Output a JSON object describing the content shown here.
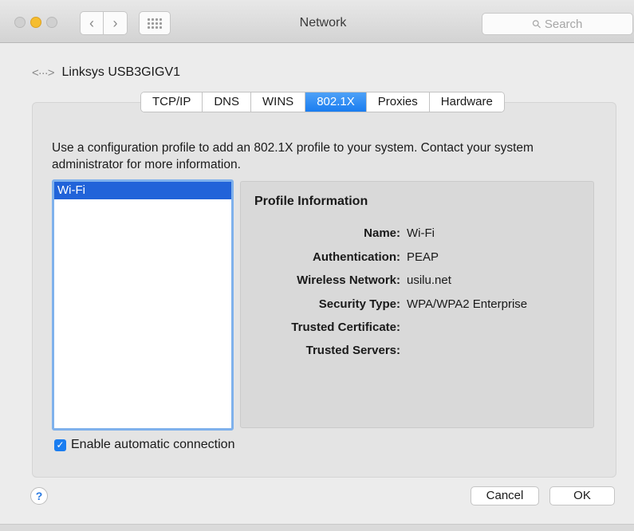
{
  "window": {
    "title": "Network"
  },
  "toolbar": {
    "back_glyph": "‹",
    "forward_glyph": "›",
    "search_placeholder": "Search"
  },
  "interface": {
    "icon": "<···>",
    "name": "Linksys USB3GIGV1"
  },
  "tabs": [
    {
      "label": "TCP/IP",
      "active": false
    },
    {
      "label": "DNS",
      "active": false
    },
    {
      "label": "WINS",
      "active": false
    },
    {
      "label": "802.1X",
      "active": true
    },
    {
      "label": "Proxies",
      "active": false
    },
    {
      "label": "Hardware",
      "active": false
    }
  ],
  "description": "Use a configuration profile to add an 802.1X profile to your system. Contact your system administrator for more information.",
  "profiles": [
    {
      "label": "Wi-Fi",
      "selected": true
    }
  ],
  "profile_info": {
    "title": "Profile Information",
    "rows": [
      {
        "key": "Name:",
        "value": "Wi-Fi"
      },
      {
        "key": "Authentication:",
        "value": "PEAP"
      },
      {
        "key": "Wireless Network:",
        "value": "usilu.net"
      },
      {
        "key": "Security Type:",
        "value": "WPA/WPA2 Enterprise"
      },
      {
        "key": "Trusted Certificate:",
        "value": ""
      },
      {
        "key": "Trusted Servers:",
        "value": ""
      }
    ]
  },
  "auto_connect": {
    "label": "Enable automatic connection",
    "checked": true
  },
  "footer": {
    "help": "?",
    "cancel": "Cancel",
    "ok": "OK"
  },
  "colors": {
    "accent": "#1a7df0",
    "selection": "#2163d9"
  }
}
